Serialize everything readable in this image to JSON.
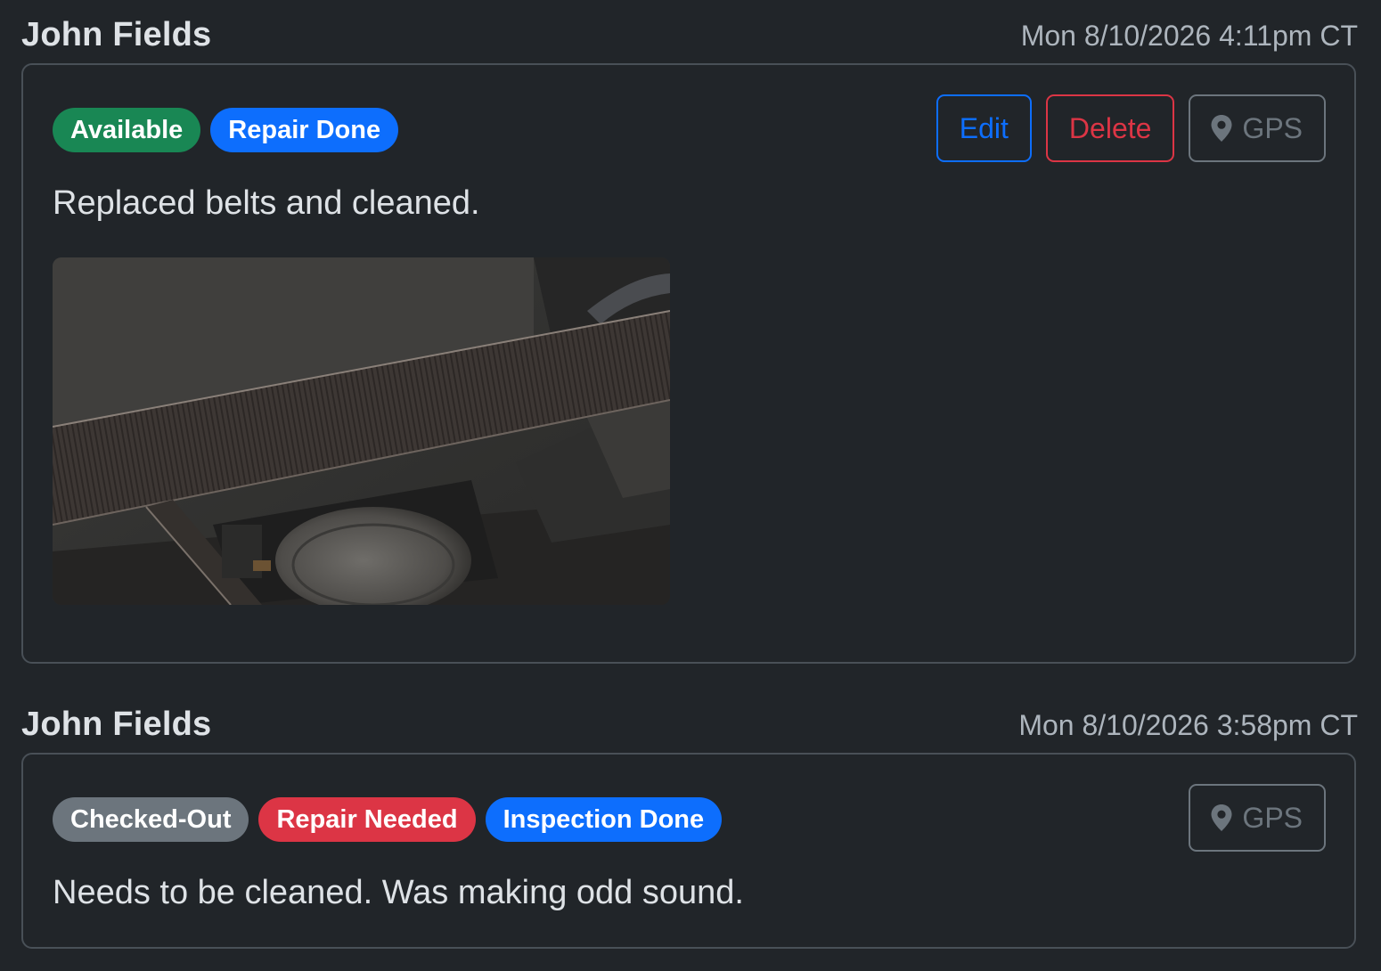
{
  "entries": [
    {
      "author": "John Fields",
      "timestamp": "Mon 8/10/2026 4:11pm CT",
      "badges": [
        {
          "label": "Available",
          "color": "#198754"
        },
        {
          "label": "Repair Done",
          "color": "#0d6efd"
        }
      ],
      "actions": {
        "edit_label": "Edit",
        "delete_label": "Delete",
        "gps_label": "GPS"
      },
      "note": "Replaced belts and cleaned.",
      "photo": {
        "alt": "belt"
      }
    },
    {
      "author": "John Fields",
      "timestamp": "Mon 8/10/2026 3:58pm CT",
      "badges": [
        {
          "label": "Checked-Out",
          "color": "#6c757d"
        },
        {
          "label": "Repair Needed",
          "color": "#dc3545"
        },
        {
          "label": "Inspection Done",
          "color": "#0d6efd"
        }
      ],
      "actions": {
        "gps_label": "GPS"
      },
      "note": "Needs to be cleaned. Was making odd sound."
    }
  ],
  "icons": {
    "gps": "map-pin-icon"
  }
}
